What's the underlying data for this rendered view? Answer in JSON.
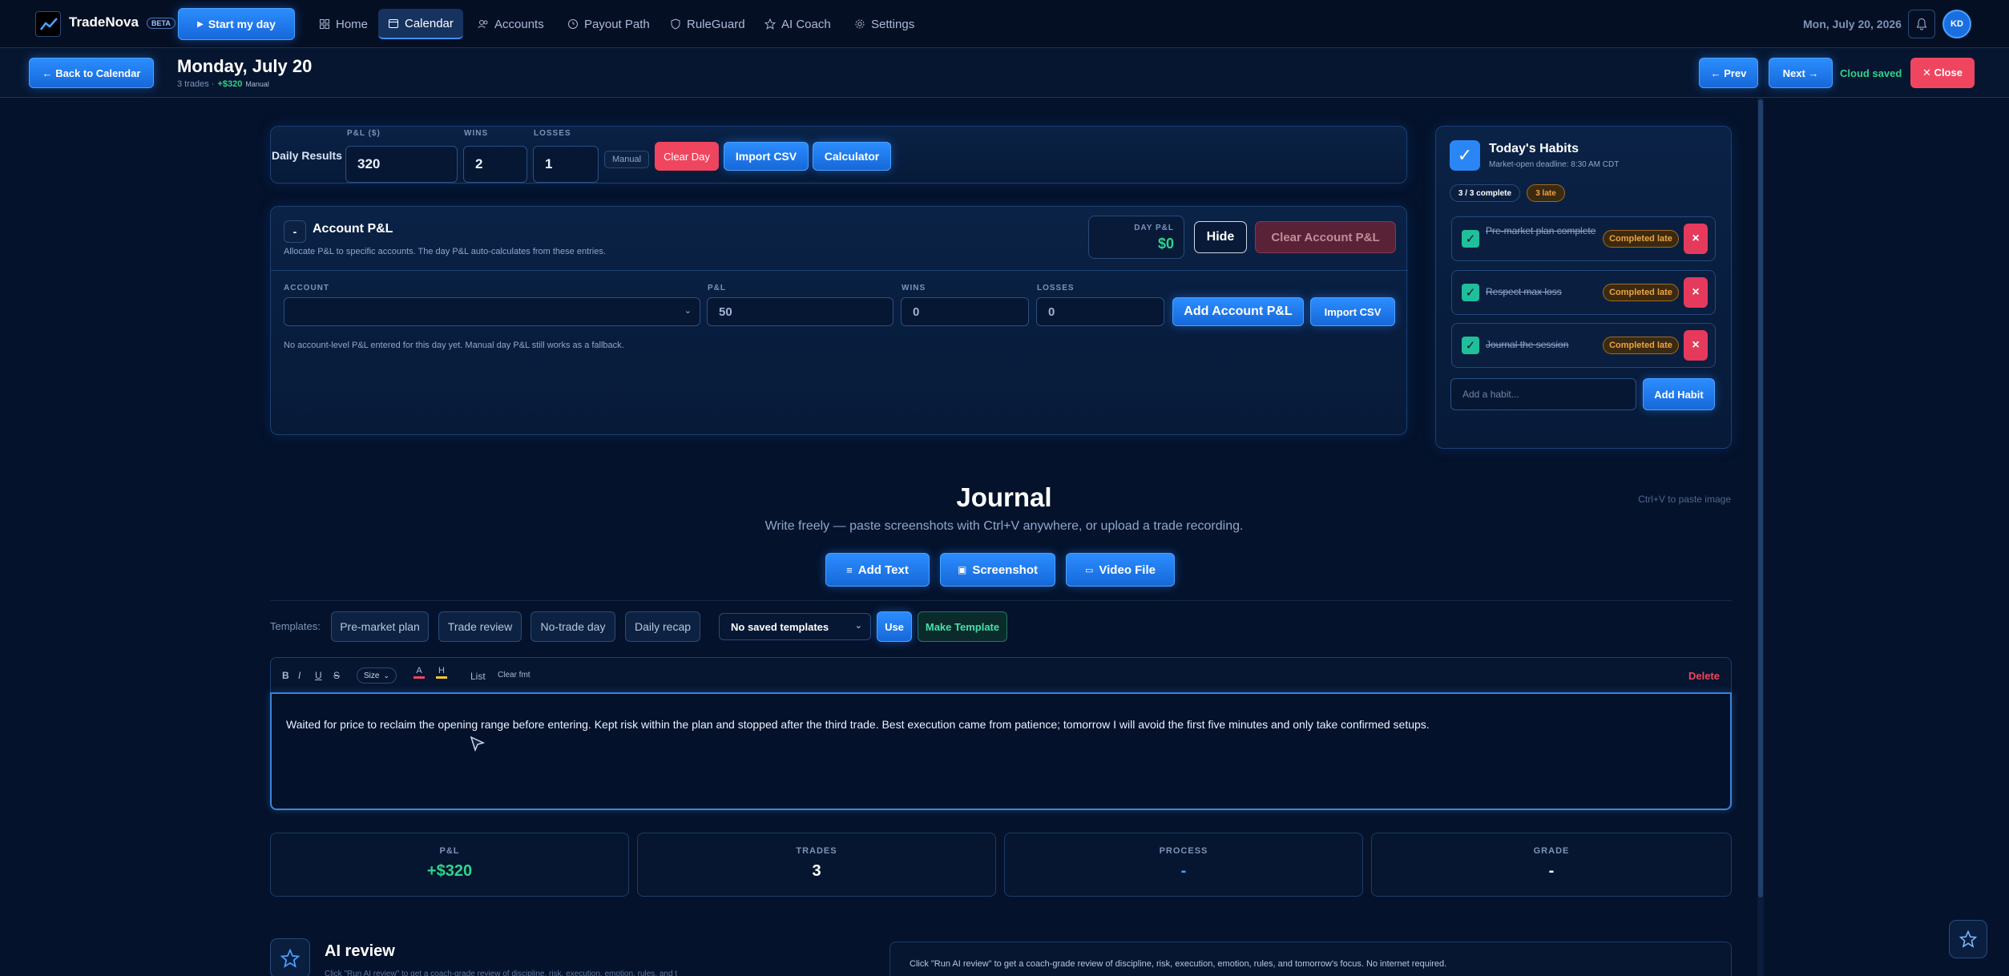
{
  "app": {
    "name": "TradeNova",
    "beta_badge": "BETA",
    "start_day_label": "Start my day",
    "date_display": "Mon, July 20, 2026",
    "avatar_initials": "KD"
  },
  "nav": {
    "items": [
      {
        "label": "Home",
        "icon": "home-icon"
      },
      {
        "label": "Calendar",
        "icon": "calendar-icon",
        "active": true
      },
      {
        "label": "Accounts",
        "icon": "users-icon"
      },
      {
        "label": "Payout Path",
        "icon": "target-icon"
      },
      {
        "label": "RuleGuard",
        "icon": "shield-icon"
      },
      {
        "label": "AI Coach",
        "icon": "star-icon"
      },
      {
        "label": "Settings",
        "icon": "gear-icon"
      }
    ]
  },
  "day_header": {
    "back_label": "← Back to Calendar",
    "title": "Monday, July 20",
    "trades_text": "3 trades ·",
    "pnl_text": "+$320",
    "manual_tag": "Manual",
    "prev_label": "← Prev",
    "next_label": "Next →",
    "cloud_status": "Cloud saved",
    "close_label": "✕ Close"
  },
  "daily_results": {
    "label": "Daily Results",
    "pnl_label": "P&L ($)",
    "pnl_value": "320",
    "wins_label": "WINS",
    "wins_value": "2",
    "losses_label": "LOSSES",
    "losses_value": "1",
    "manual_tag": "Manual",
    "clear_day": "Clear Day",
    "import_csv": "Import CSV",
    "calculator": "Calculator"
  },
  "account_pnl": {
    "collapse_symbol": "-",
    "title": "Account P&L",
    "subtitle": "Allocate P&L to specific accounts. The day P&L auto-calculates from these entries.",
    "day_pnl_label": "DAY P&L",
    "day_pnl_value": "$0",
    "hide_label": "Hide",
    "clear_label": "Clear Account P&L",
    "account_col": "ACCOUNT",
    "pnl_col": "P&L",
    "wins_col": "WINS",
    "losses_col": "LOSSES",
    "pnl_input": "50",
    "wins_input": "0",
    "losses_input": "0",
    "add_label": "Add Account P&L",
    "import_label": "Import CSV",
    "empty_note": "No account-level P&L entered for this day yet. Manual day P&L still works as a fallback."
  },
  "habits": {
    "title": "Today's Habits",
    "deadline": "Market-open deadline: 8:30 AM CDT",
    "complete_badge": "3 / 3 complete",
    "late_badge": "3 late",
    "items": [
      {
        "label": "Pre-market plan complete",
        "status": "Completed late"
      },
      {
        "label": "Respect max loss",
        "status": "Completed late"
      },
      {
        "label": "Journal the session",
        "status": "Completed late"
      }
    ],
    "add_placeholder": "Add a habit...",
    "add_label": "Add Habit"
  },
  "journal": {
    "title": "Journal",
    "subtitle": "Write freely — paste screenshots with Ctrl+V anywhere, or upload a trade recording.",
    "paste_hint": "Ctrl+V to paste image",
    "add_text": "Add Text",
    "screenshot": "Screenshot",
    "video_file": "Video File",
    "templates_label": "Templates:",
    "templates": [
      "Pre-market plan",
      "Trade review",
      "No-trade day",
      "Daily recap"
    ],
    "saved_templates": "No saved templates",
    "use_label": "Use",
    "make_template": "Make Template",
    "toolbar": {
      "bold": "B",
      "italic": "I",
      "underline": "U",
      "strike": "S",
      "size": "Size",
      "color": "A",
      "highlight": "H",
      "list": "List",
      "clear_format": "Clear fmt",
      "delete": "Delete"
    },
    "body": "Waited for price to reclaim the opening range before entering. Kept risk within the plan and stopped after the third trade. Best execution came from patience; tomorrow I will avoid the first five minutes and only take confirmed setups."
  },
  "stats": [
    {
      "label": "P&L",
      "value": "+$320",
      "color": "#2fd38a"
    },
    {
      "label": "TRADES",
      "value": "3",
      "color": "#ffffff"
    },
    {
      "label": "PROCESS",
      "value": "-",
      "color": "#4aa2ff"
    },
    {
      "label": "GRADE",
      "value": "-",
      "color": "#ffffff"
    }
  ],
  "ai_review": {
    "title": "AI review",
    "subtitle": "Click \"Run AI review\" to get a coach-grade review of discipline, risk, execution, emotion, rules, and tomorrow's focus. No internet required.",
    "description": "Click \"Run AI review\" to get a coach-grade review of discipline, risk, execution, emotion, rules, and tomorrow's focus. No internet required."
  }
}
